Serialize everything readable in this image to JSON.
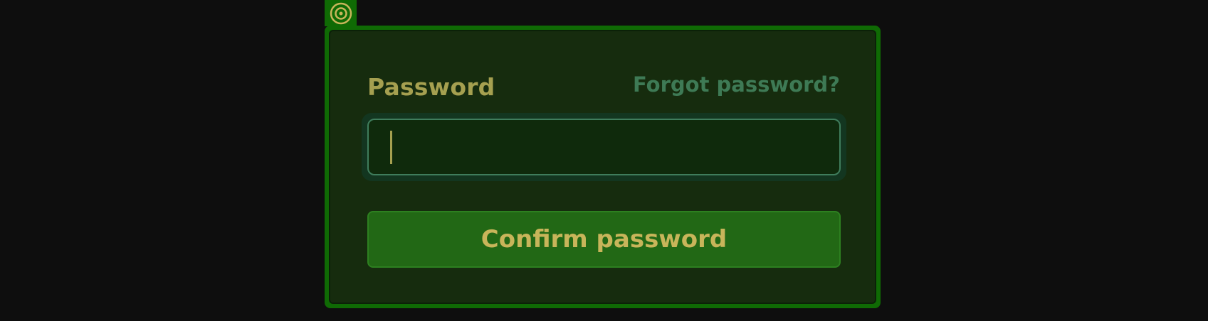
{
  "badge": {
    "icon": "target-icon",
    "color": "#c8b55a"
  },
  "form": {
    "password_label": "Password",
    "forgot_link": "Forgot password?",
    "password_value": "",
    "confirm_button": "Confirm password"
  },
  "colors": {
    "background": "#0e0e0e",
    "panel_border": "#0f6a04",
    "panel_fill": "#162c0e",
    "label": "#a5a050",
    "link": "#3e7a55",
    "input_border": "#3f7d5c",
    "button_fill": "#226815",
    "button_text": "#c8b55a"
  }
}
